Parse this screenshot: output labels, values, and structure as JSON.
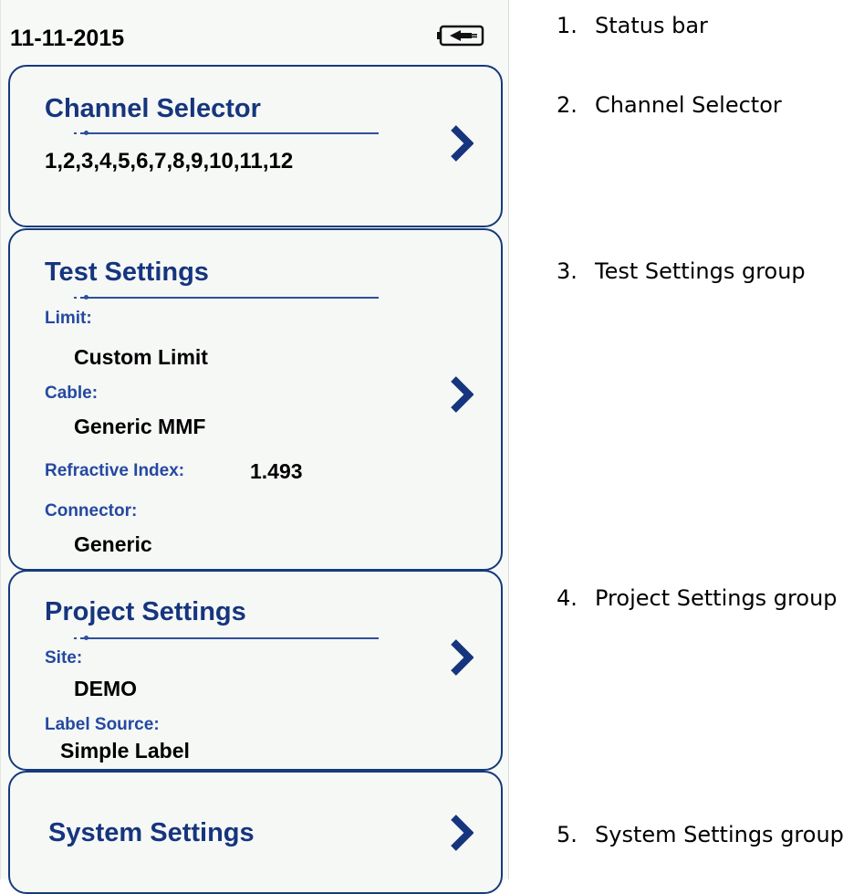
{
  "status_bar": {
    "date": "11-11-2015",
    "icon": "battery-charging-icon"
  },
  "cards": {
    "channel": {
      "title": "Channel Selector",
      "value": "1,2,3,4,5,6,7,8,9,10,11,12"
    },
    "test": {
      "title": "Test Settings",
      "limit_label": "Limit:",
      "limit_value": "Custom Limit",
      "cable_label": "Cable:",
      "cable_value": "Generic MMF",
      "ri_label": "Refractive Index:",
      "ri_value": "1.493",
      "connector_label": "Connector:",
      "connector_value": "Generic"
    },
    "project": {
      "title": "Project Settings",
      "site_label": "Site:",
      "site_value": "DEMO",
      "label_source_label": "Label Source:",
      "label_source_value": "Simple Label"
    },
    "system": {
      "title": "System Settings"
    }
  },
  "annotations": [
    {
      "num": "1.",
      "text": "Status bar"
    },
    {
      "num": "2.",
      "text": "Channel Selector"
    },
    {
      "num": "3.",
      "text": "Test Settings group"
    },
    {
      "num": "4.",
      "text": "Project Settings group"
    },
    {
      "num": "5.",
      "text": "System Settings group"
    }
  ],
  "colors": {
    "accent": "#16357e",
    "label": "#2449a0",
    "border": "#163a7a",
    "background": "#f7f9f7"
  }
}
